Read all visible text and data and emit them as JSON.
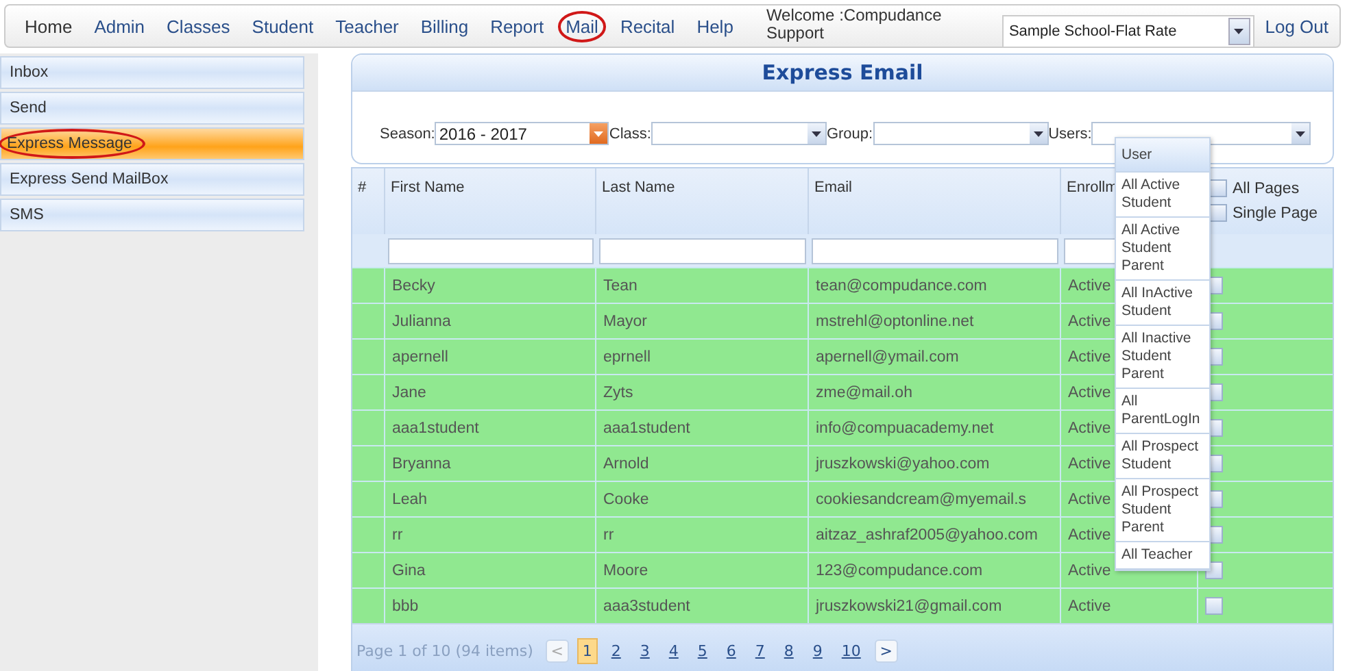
{
  "nav": {
    "items": [
      {
        "label": "Home",
        "highlighted": false
      },
      {
        "label": "Admin",
        "highlighted": false
      },
      {
        "label": "Classes",
        "highlighted": false
      },
      {
        "label": "Student",
        "highlighted": false
      },
      {
        "label": "Teacher",
        "highlighted": false
      },
      {
        "label": "Billing",
        "highlighted": false
      },
      {
        "label": "Report",
        "highlighted": false
      },
      {
        "label": "Mail",
        "highlighted": true
      },
      {
        "label": "Recital",
        "highlighted": false
      },
      {
        "label": "Help",
        "highlighted": false
      }
    ],
    "welcome": "Welcome :Compudance Support",
    "school": "Sample School-Flat Rate",
    "logout": "Log Out"
  },
  "sidebar": {
    "items": [
      {
        "label": "Inbox",
        "selected": false,
        "highlighted": false
      },
      {
        "label": "Send",
        "selected": false,
        "highlighted": false
      },
      {
        "label": "Express Message",
        "selected": true,
        "highlighted": true
      },
      {
        "label": "Express Send MailBox",
        "selected": false,
        "highlighted": false
      },
      {
        "label": "SMS",
        "selected": false,
        "highlighted": false
      }
    ]
  },
  "panel": {
    "title": "Express Email",
    "filters": [
      {
        "label": "Season:",
        "value": "2016 - 2017",
        "kind": "season"
      },
      {
        "label": "Class:",
        "kind": "plain"
      },
      {
        "label": "Group:",
        "kind": "plain"
      },
      {
        "label": "Users:",
        "kind": "users"
      }
    ],
    "users_dropdown": [
      {
        "label": "User",
        "selected": true
      },
      {
        "label": "All Active Student",
        "selected": false
      },
      {
        "label": "All Active Student Parent",
        "selected": false
      },
      {
        "label": "All InActive Student",
        "selected": false
      },
      {
        "label": "All Inactive Student Parent",
        "selected": false
      },
      {
        "label": "All ParentLogIn",
        "selected": false
      },
      {
        "label": "All Prospect Student",
        "selected": false
      },
      {
        "label": "All Prospect Student Parent",
        "selected": false
      },
      {
        "label": "All Teacher",
        "selected": false
      }
    ],
    "table": {
      "columns": [
        "#",
        "First Name",
        "Last Name",
        "Email",
        "Enrollm"
      ],
      "select_options": [
        {
          "label": "All Pages",
          "checked": false
        },
        {
          "label": "Single Page",
          "checked": false
        }
      ],
      "rows": [
        {
          "first": "Becky",
          "last": "Tean",
          "email": "tean@compudance.com",
          "status": "Active",
          "checked": false
        },
        {
          "first": "Julianna",
          "last": "Mayor",
          "email": "mstrehl@optonline.net",
          "status": "Active",
          "checked": false
        },
        {
          "first": "apernell",
          "last": "eprnell",
          "email": "apernell@ymail.com",
          "status": "Active",
          "checked": false
        },
        {
          "first": "Jane",
          "last": "Zyts",
          "email": "zme@mail.oh",
          "status": "Active",
          "checked": false
        },
        {
          "first": "aaa1student",
          "last": "aaa1student",
          "email": "info@compuacademy.net",
          "status": "Active",
          "checked": false
        },
        {
          "first": "Bryanna",
          "last": "Arnold",
          "email": "jruszkowski@yahoo.com",
          "status": "Active",
          "checked": false
        },
        {
          "first": "Leah",
          "last": "Cooke",
          "email": "cookiesandcream@myemail.s",
          "status": "Active",
          "checked": false
        },
        {
          "first": "rr",
          "last": "rr",
          "email": "aitzaz_ashraf2005@yahoo.com",
          "status": "Active",
          "checked": false
        },
        {
          "first": "Gina",
          "last": "Moore",
          "email": "123@compudance.com",
          "status": "Active",
          "checked": false
        },
        {
          "first": "bbb",
          "last": "aaa3student",
          "email": "jruszkowski21@gmail.com",
          "status": "Active",
          "checked": false
        }
      ]
    },
    "pager": {
      "summary": "Page 1 of 10 (94 items)",
      "prev": "<",
      "next": ">",
      "pages": [
        {
          "label": "1",
          "selected": true
        },
        {
          "label": "2",
          "selected": false
        },
        {
          "label": "3",
          "selected": false
        },
        {
          "label": "4",
          "selected": false
        },
        {
          "label": "5",
          "selected": false
        },
        {
          "label": "6",
          "selected": false
        },
        {
          "label": "7",
          "selected": false
        },
        {
          "label": "8",
          "selected": false
        },
        {
          "label": "9",
          "selected": false
        },
        {
          "label": "10",
          "selected": false
        }
      ]
    }
  }
}
